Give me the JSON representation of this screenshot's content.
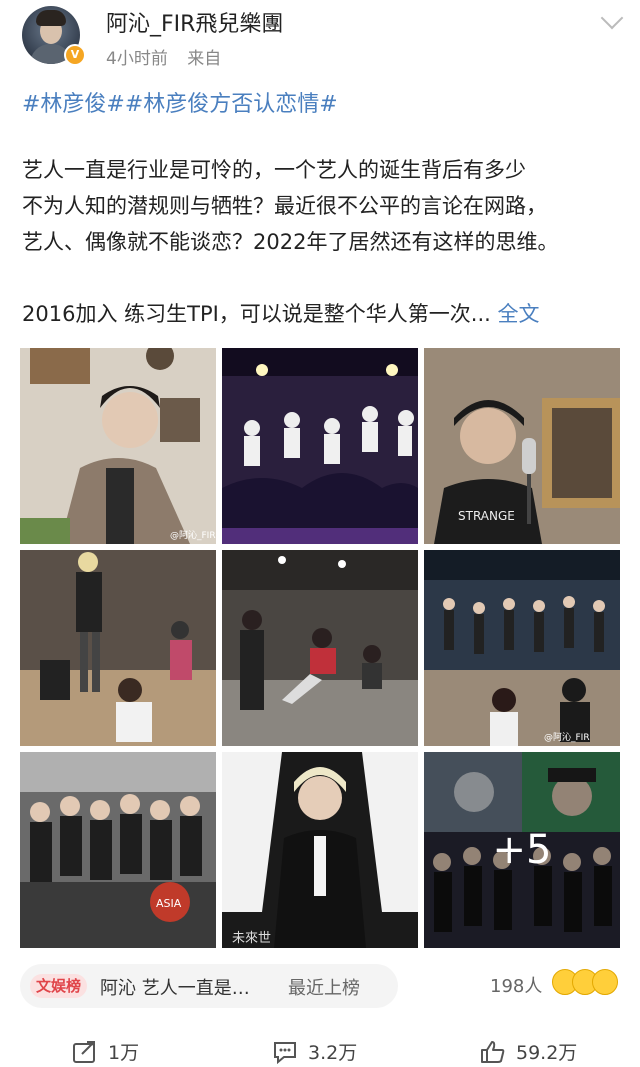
{
  "header": {
    "username": "阿沁_FIR飛兒樂團",
    "time": "4小时前",
    "source": "来自",
    "verified_color": "#f5a623"
  },
  "post": {
    "hashtags": "#林彦俊##林彦俊方否认恋情#",
    "lines": [
      "艺人一直是行业是可怜的，一个艺人的诞生背后有多少",
      "不为人知的潜规则与牺牲？最近很不公平的言论在网路，",
      "艺人、偶像就不能谈恋？2022年了居然还有这样的思维。"
    ],
    "line4": "2016加入 练习生TPI，可以说是整个华人第一次...",
    "read_more": "全文",
    "accent_color": "#4a7fbf"
  },
  "gallery": {
    "watermark": "@阿沁_FIR飛兒樂團",
    "more_count": "+5",
    "cells": [
      {
        "icon": "photo-portrait"
      },
      {
        "icon": "photo-stage"
      },
      {
        "icon": "photo-studio"
      },
      {
        "icon": "photo-rehearsal"
      },
      {
        "icon": "photo-practice"
      },
      {
        "icon": "photo-dance"
      },
      {
        "icon": "photo-press"
      },
      {
        "icon": "photo-red-carpet"
      },
      {
        "icon": "photo-poster"
      }
    ]
  },
  "trend": {
    "badge": "文娱榜",
    "text": "阿沁  艺人一直是…",
    "status": "最近上榜",
    "badge_color": "#e0454a"
  },
  "reactions": {
    "count": "198人"
  },
  "footer": {
    "repost": "1万",
    "comment": "3.2万",
    "like": "59.2万"
  }
}
